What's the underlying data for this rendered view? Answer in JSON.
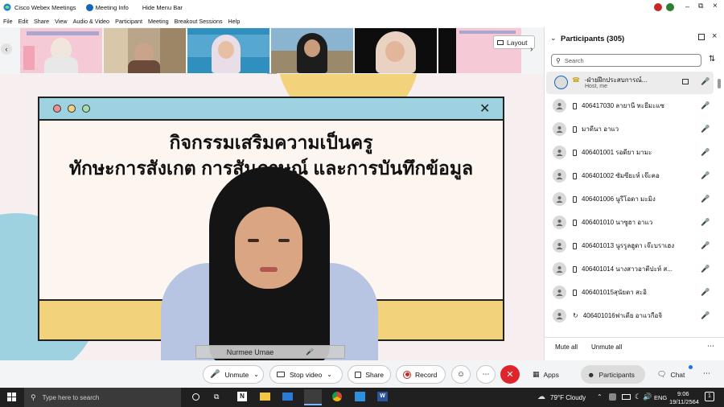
{
  "window": {
    "title": "Cisco Webex Meetings",
    "meeting_info": "Meeting Info",
    "hide_menu_bar": "Hide Menu Bar"
  },
  "menu": [
    "File",
    "Edit",
    "Share",
    "View",
    "Audio & Video",
    "Participant",
    "Meeting",
    "Breakout Sessions",
    "Help"
  ],
  "layout_button": "Layout",
  "slide": {
    "title_line1": "กิจกรรมเสริมความเป็นครู",
    "title_line2": "ทักษะการสังเกต การสัมภาษณ์ และการบันทึกข้อมูล"
  },
  "active_speaker": "Nurmee Umae",
  "participants_panel": {
    "title": "Participants (305)",
    "search_placeholder": "Search",
    "host": {
      "name": "-ฝ่ายฝึกประสบการณ์...",
      "role": "Host, me"
    },
    "items": [
      "406417030 ลายานี หะยีมะแซ",
      "มาดีนา อาแว",
      "406401001 รอดียา มามะ",
      "406401002 ซัมซียะห์ เจ๊ะคอ",
      "406401006 นูรีโอดา มะมิง",
      "406401010 นาซูฮา อาแว",
      "406401013 นูรรูลฮูดา เจ๊ะบราเฮง",
      "406401014 นางสาวอาตีปะห์ ส...",
      "406401015สุนัยดา สะอิ",
      "406401016ฟาเดีย อาแวกือจิ"
    ],
    "mute_all": "Mute all",
    "unmute_all": "Unmute all"
  },
  "toolbar": {
    "unmute": "Unmute",
    "stop_video": "Stop video",
    "share": "Share",
    "record": "Record",
    "apps": "Apps",
    "participants": "Participants",
    "chat": "Chat"
  },
  "taskbar": {
    "search_placeholder": "Type here to search",
    "weather": "79°F  Cloudy",
    "lang": "ENG",
    "time": "9:06",
    "date": "19/11/2564",
    "notif_count": "1"
  },
  "colors": {
    "accent_red": "#e0242b",
    "slide_blue": "#9fd2e0",
    "slide_yellow": "#f2d27a"
  }
}
